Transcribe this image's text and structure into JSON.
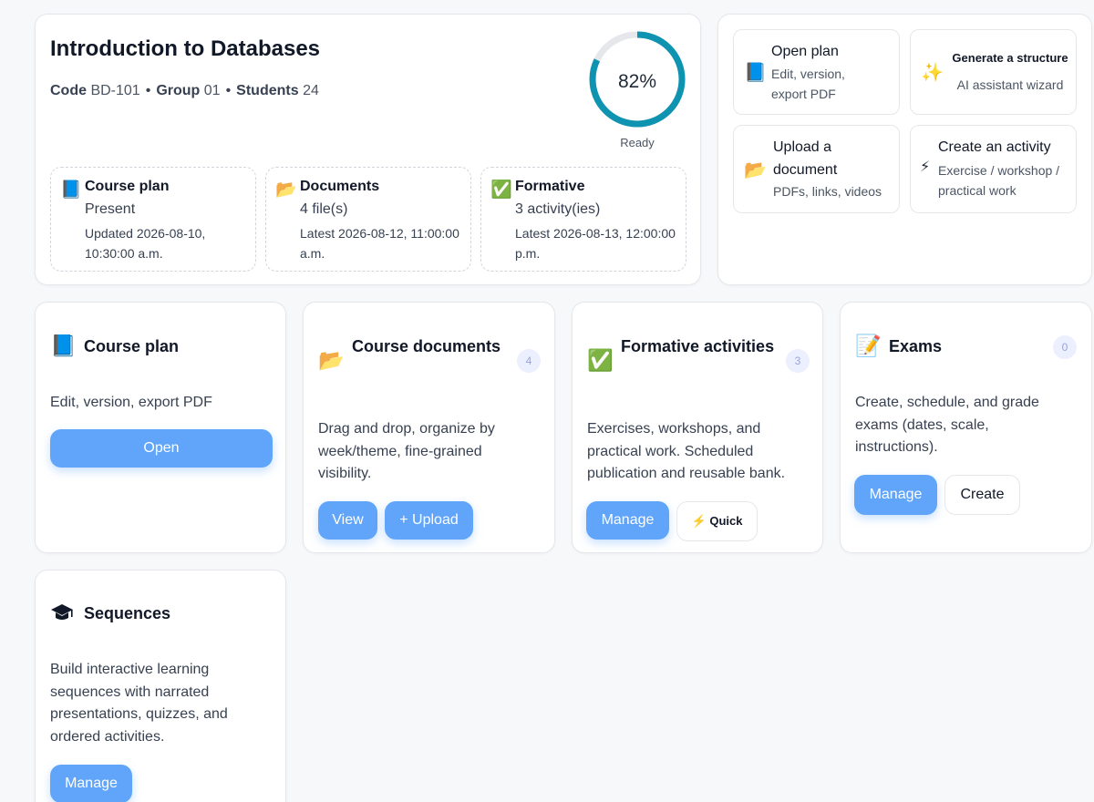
{
  "course": {
    "title": "Introduction to Databases",
    "code_label": "Code",
    "code_value": "BD-101",
    "group_label": "Group",
    "group_value": "01",
    "students_label": "Students",
    "students_value": "24",
    "separator": "•",
    "readiness": {
      "value": "82%",
      "fraction": 0.82,
      "label": "Ready"
    }
  },
  "stats": [
    {
      "icon": "📘",
      "title": "Course plan",
      "value": "Present",
      "sub": "Updated 2026-08-10, 10:30:00 a.m."
    },
    {
      "icon": "📂",
      "title": "Documents",
      "value": "4 file(s)",
      "sub": "Latest 2026-08-12, 11:00:00 a.m."
    },
    {
      "icon": "✅",
      "title": "Formative",
      "value": "3 activity(ies)",
      "sub": "Latest 2026-08-13, 12:00:00 p.m."
    }
  ],
  "quick_actions": [
    {
      "icon": "📘",
      "title": "Open plan",
      "sub": "Edit, version, export PDF"
    },
    {
      "icon": "✨",
      "title": "Generate a structure",
      "sub": "AI assistant wizard"
    },
    {
      "icon": "📂",
      "title": "Upload a document",
      "sub": "PDFs, links, videos"
    },
    {
      "icon": "⚡",
      "title": "Create an activity",
      "sub": "Exercise / workshop / practical work"
    }
  ],
  "modules": {
    "plan": {
      "icon": "📘",
      "title": "Course plan",
      "desc": "Edit, version, export PDF",
      "open": "Open"
    },
    "docs": {
      "icon": "📂",
      "title": "Course documents",
      "count": "4",
      "desc": "Drag and drop, organize by week/theme, fine-grained visibility.",
      "view": "View",
      "upload": "+ Upload"
    },
    "formative": {
      "icon": "✅",
      "title": "Formative activities",
      "count": "3",
      "desc": "Exercises, workshops, and practical work. Scheduled publication and reusable bank.",
      "manage": "Manage",
      "quick_icon": "⚡",
      "quick": "Quick"
    },
    "exams": {
      "icon": "📝",
      "title": "Exams",
      "count": "0",
      "desc": "Create, schedule, and grade exams (dates, scale, instructions).",
      "manage": "Manage",
      "create": "Create"
    },
    "sequences": {
      "icon": "🎓",
      "title": "Sequences",
      "desc": "Build interactive learning sequences with narrated presentations, quizzes, and ordered activities.",
      "manage": "Manage"
    }
  },
  "colors": {
    "accent": "#60a5fa",
    "ring": "#0e93b0",
    "ring_track": "#e5e7eb",
    "badge_bg": "#eceffd"
  }
}
